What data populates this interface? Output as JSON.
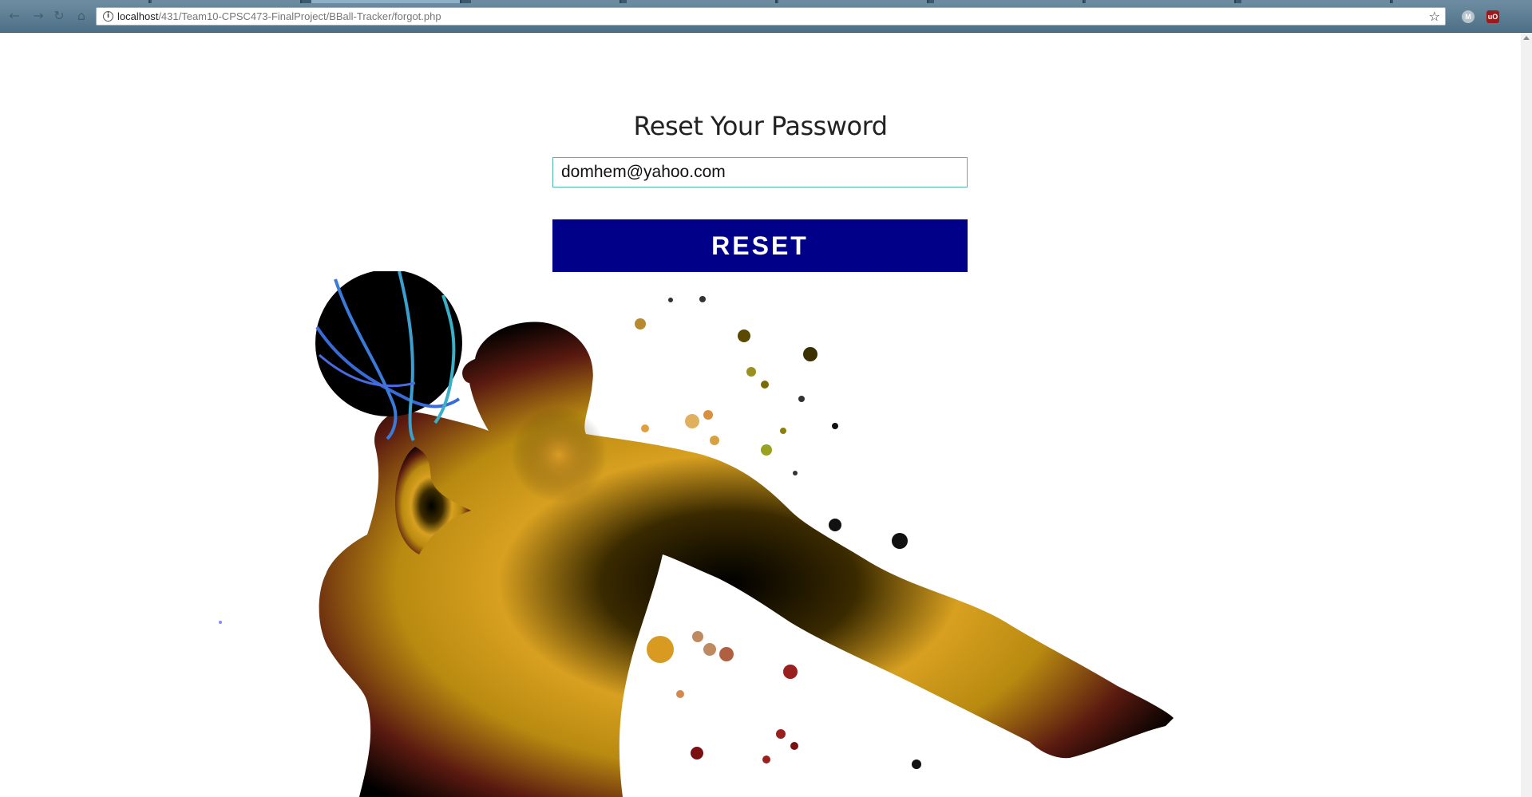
{
  "browser": {
    "url_host": "localhost",
    "url_path": "/431/Team10-CPSC473-FinalProject/BBall-Tracker/forgot.php",
    "extensions": [
      "M",
      "uO"
    ]
  },
  "page": {
    "title": "Reset Your Password",
    "email_value": "domhem@yahoo.com",
    "reset_label": "RESET"
  },
  "colors": {
    "button_bg": "#000088",
    "input_border": "#4fb6a8",
    "browser_chrome": "#5a7c92"
  },
  "icons": {
    "back": "back-arrow-icon",
    "forward": "forward-arrow-icon",
    "reload": "reload-icon",
    "home": "home-icon",
    "info": "info-icon",
    "bookmark": "star-icon"
  }
}
